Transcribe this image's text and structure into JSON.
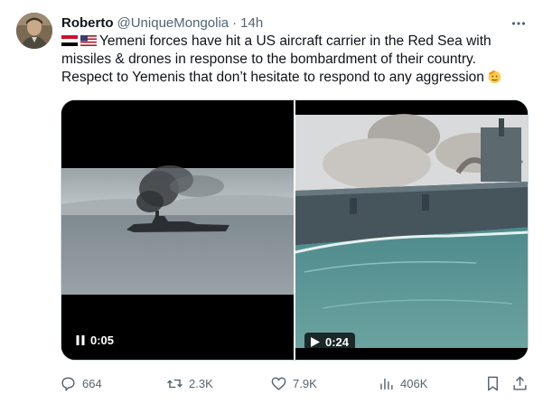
{
  "post": {
    "author_name": "Roberto",
    "handle": "@UniqueMongolia",
    "separator": "·",
    "time": "14h",
    "text": "Yemeni forces have hit a US aircraft carrier in the Red Sea with missiles & drones in response to the bombardment of their country. Respect to Yemenis that don’t hesitate to respond to any aggression",
    "leading_icons": [
      "yemen-flag-icon",
      "us-flag-icon"
    ],
    "trailing_icon": "saluting-face-icon"
  },
  "media": {
    "videos": [
      {
        "duration": "0:05",
        "control": "pause-icon"
      },
      {
        "duration": "0:24",
        "control": "play-icon"
      }
    ]
  },
  "actions": {
    "replies": "664",
    "reposts": "2.3K",
    "likes": "7.9K",
    "views": "406K"
  },
  "colors": {
    "text": "#0f1419",
    "secondary": "#536471",
    "border": "#cfd9de"
  }
}
